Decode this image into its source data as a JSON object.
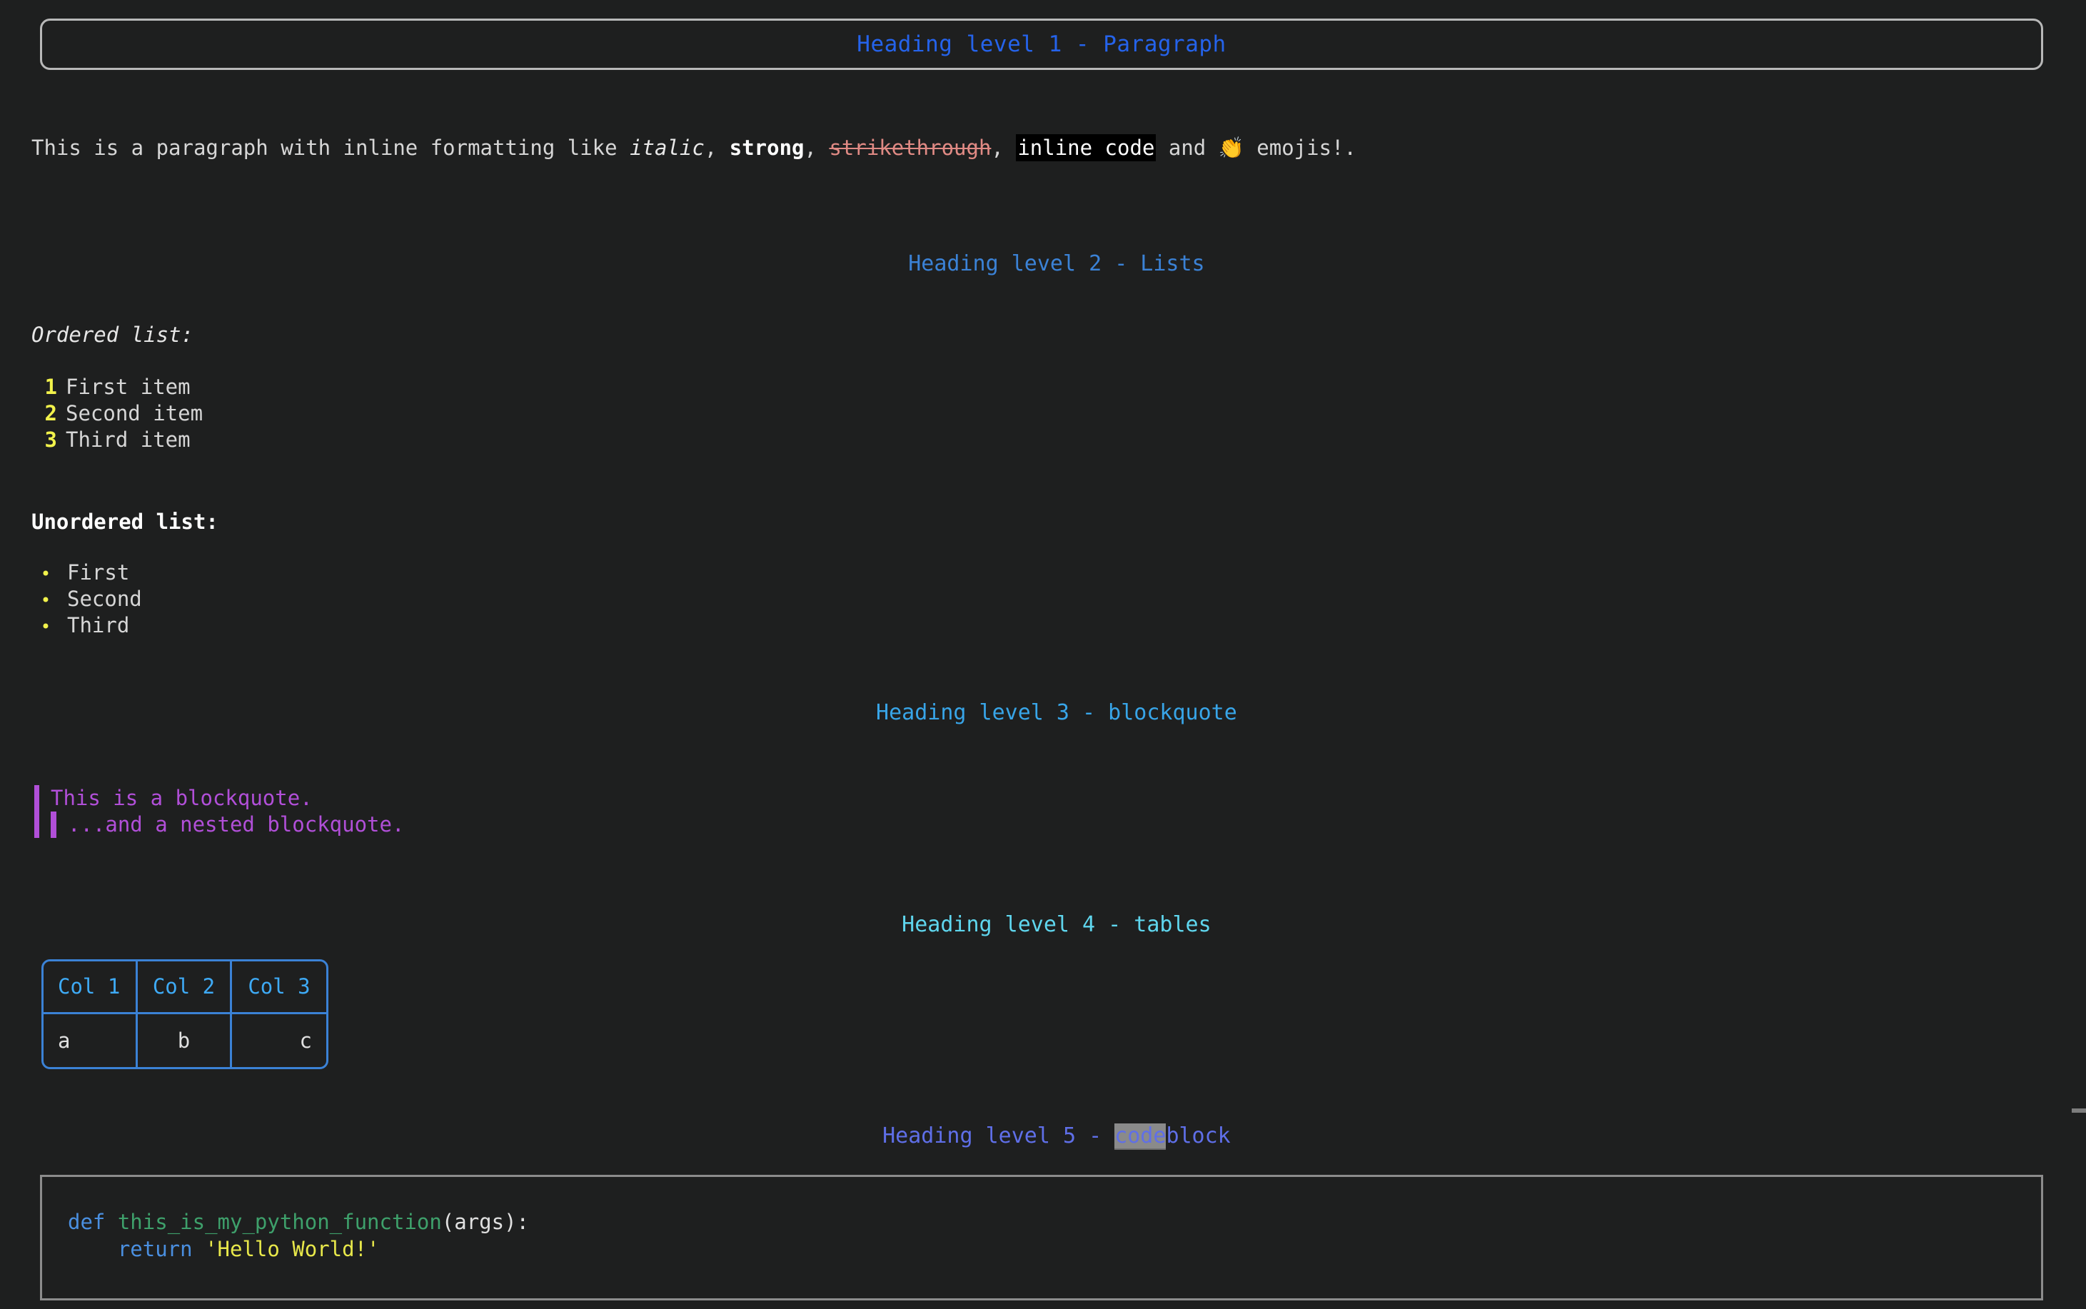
{
  "document": {
    "heading1": "Heading level 1 - Paragraph",
    "paragraph": {
      "part1": "This is a paragraph with inline formatting like ",
      "italic": "italic",
      "sep1": ", ",
      "strong": "strong",
      "sep2": ", ",
      "strikethrough": "strikethrough",
      "sep3": ", ",
      "inline_code": "inline code",
      "sep4": " and ",
      "emoji": "👏",
      "tail": " emojis!."
    },
    "heading2": "Heading level 2 - Lists",
    "ordered_label": "Ordered list:",
    "ordered_items": [
      {
        "marker": "1",
        "text": "First item"
      },
      {
        "marker": "2",
        "text": "Second item"
      },
      {
        "marker": "3",
        "text": "Third item"
      }
    ],
    "unordered_label": "Unordered list:",
    "unordered_items": [
      {
        "marker": "•",
        "text": "First"
      },
      {
        "marker": "•",
        "text": "Second"
      },
      {
        "marker": "•",
        "text": "Third"
      }
    ],
    "heading3": "Heading level 3 - blockquote",
    "blockquote": {
      "line1": "This is a blockquote.",
      "line2": "...and a nested blockquote."
    },
    "heading4": "Heading level 4 - tables",
    "table": {
      "headers": [
        "Col 1",
        "Col 2",
        "Col 3"
      ],
      "rows": [
        [
          "a",
          "b",
          "c"
        ]
      ]
    },
    "heading5": {
      "prefix": "Heading level 5 - ",
      "code": "code",
      "suffix": "block"
    },
    "codeblock": {
      "language": "python",
      "line1_kw": "def",
      "line1_fn": " this_is_my_python_function",
      "line1_pl": "(args):",
      "line2_indent": "    ",
      "line2_kw": "return",
      "line2_str": " 'Hello World!'"
    }
  },
  "colors": {
    "background": "#1e1f1f",
    "heading1": "#2563eb",
    "heading2": "#3b82d6",
    "heading3": "#38a5e8",
    "heading4": "#5fd6ee",
    "heading5": "#5f6fe8",
    "blockquote": "#b14fd8",
    "list_marker": "#f2f24b",
    "table_border": "#3b82d6",
    "strikethrough": "#e08a84",
    "code_keyword": "#4a8fe0",
    "code_function": "#3ea06b",
    "code_string": "#e8e84a",
    "panel_border": "#b8b8b8"
  }
}
